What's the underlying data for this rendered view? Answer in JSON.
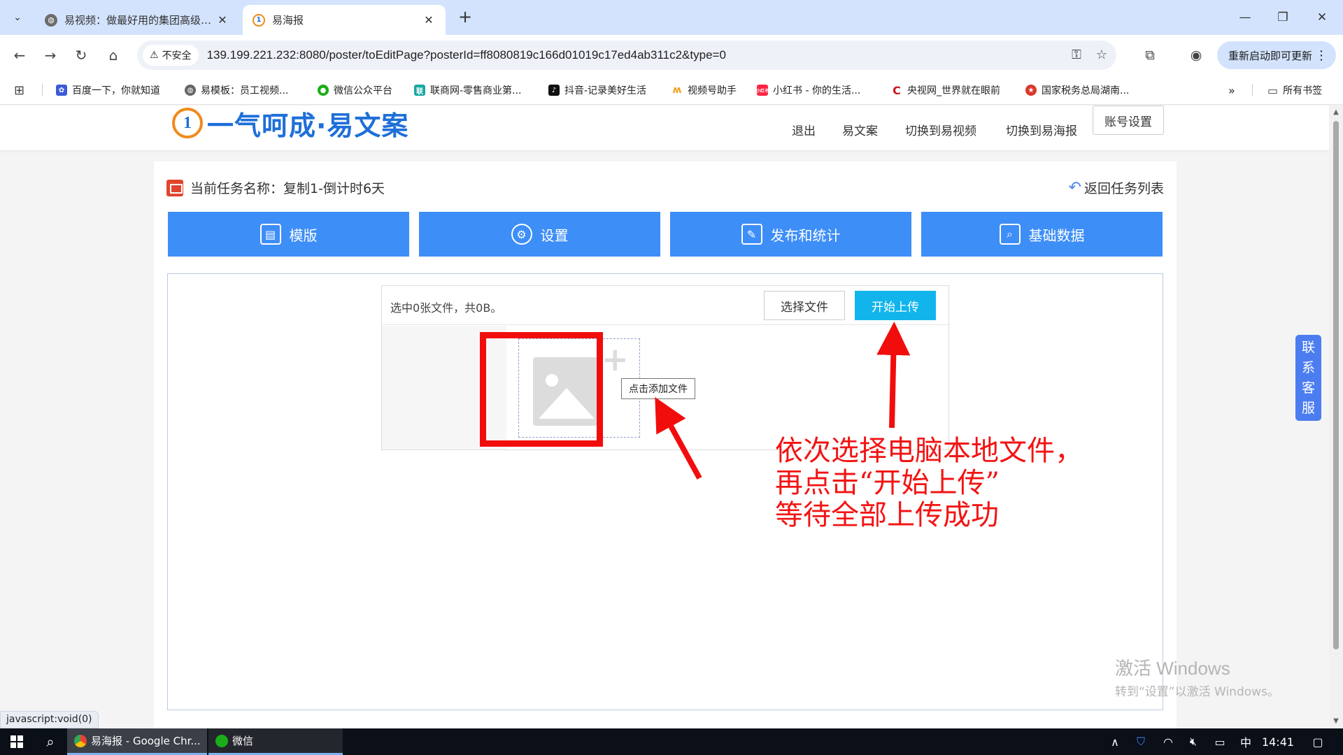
{
  "browser": {
    "tabs": [
      {
        "title": "易视频：做最好用的集团高级营销",
        "active": false
      },
      {
        "title": "易海报",
        "active": true
      }
    ],
    "new_tab": "+",
    "security_label": "不安全",
    "url": "139.199.221.232:8080/poster/toEditPage?posterId=ff8080819c166d01019c17ed4ab311c2&type=0",
    "update_button": "重新启动即可更新",
    "bookmarks": [
      "百度一下，你就知道",
      "易模板：员工视频...",
      "微信公众平台",
      "联商网-零售商业第...",
      "抖音-记录美好生活",
      "视频号助手",
      "小红书 - 你的生活...",
      "央视网_世界就在眼前",
      "国家税务总局湖南..."
    ],
    "bookmarks_more": "»",
    "all_bookmarks": "所有书签",
    "status_url": "javascript:void(0)"
  },
  "site": {
    "brand_logo": "1",
    "brand_name": "一气呵成·易文案",
    "nav": [
      "退出",
      "易文案",
      "切换到易视频",
      "切换到易海报"
    ],
    "account_button": "账号设置",
    "task_label": "当前任务名称：复制1-倒计时6天",
    "back_link": "返回任务列表",
    "main_tabs": [
      "模版",
      "设置",
      "发布和统计",
      "基础数据"
    ],
    "uploader": {
      "stat": "选中0张文件，共0B。",
      "choose_button": "选择文件",
      "start_button": "开始上传",
      "add_tooltip": "点击添加文件"
    },
    "customer_service": [
      "联",
      "系",
      "客",
      "服"
    ]
  },
  "annotation": {
    "text": "依次选择电脑本地文件，\n再点击“开始上传”\n等待全部上传成功",
    "color": "#f21414"
  },
  "watermark": {
    "line1": "激活 Windows",
    "line2": "转到“设置”以激活 Windows。"
  },
  "taskbar": {
    "apps": [
      "易海报 - Google Chr...",
      "微信"
    ],
    "ime": "中",
    "time": "14:41"
  },
  "colors": {
    "tab_blue": "#3e8ef7",
    "start_upload": "#11b5ec",
    "brand_blue": "#1e6fd9",
    "annotation_red": "#f21414"
  }
}
